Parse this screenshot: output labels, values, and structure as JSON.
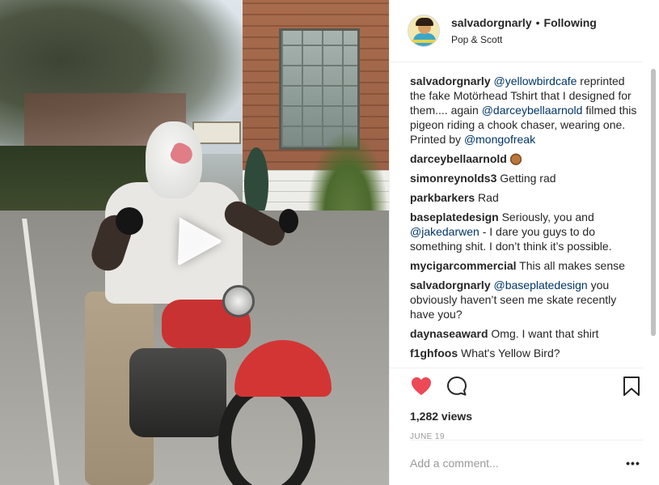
{
  "post": {
    "username": "salvadorgnarly",
    "separator": "•",
    "follow_status": "Following",
    "location": "Pop & Scott"
  },
  "caption": {
    "user": "salvadorgnarly",
    "mention1": "@yellowbirdcafe",
    "text1": " reprinted the fake Motörhead Tshirt that I designed for them.... again ",
    "mention2": "@darceybellaarnold",
    "text2": " filmed this pigeon riding a chook chaser, wearing one. Printed by ",
    "mention3": "@mongofreak"
  },
  "comments": [
    {
      "user": "darceybellaarnold",
      "text": ""
    },
    {
      "user": "simonreynolds3",
      "text": " Getting rad"
    },
    {
      "user": "parkbarkers",
      "text": " Rad"
    },
    {
      "user": "baseplatedesign",
      "text": " Seriously, you and ",
      "mention": "@jakedarwen",
      "text2": " - I dare you guys to do something shit. I don’t think it’s possible."
    },
    {
      "user": "mycigarcommercial",
      "text": " This all makes sense"
    },
    {
      "user": "salvadorgnarly",
      "mention": "@baseplatedesign",
      "text": " ",
      "text2": " you obviously haven’t seen me skate recently have you?"
    },
    {
      "user": "daynaseaward",
      "text": " Omg. I want that shirt"
    },
    {
      "user": "f1ghfoos",
      "text": " What's Yellow Bird?"
    }
  ],
  "stats": {
    "views": "1,282 views",
    "date": "JUNE 19"
  },
  "comment_input": {
    "placeholder": "Add a comment...",
    "more": "•••"
  },
  "colors": {
    "heart": "#ed4956",
    "mention": "#003569",
    "muted": "#999999",
    "text": "#262626"
  },
  "icons": [
    "play-icon",
    "heart-icon",
    "comment-icon",
    "bookmark-icon",
    "more-icon"
  ]
}
